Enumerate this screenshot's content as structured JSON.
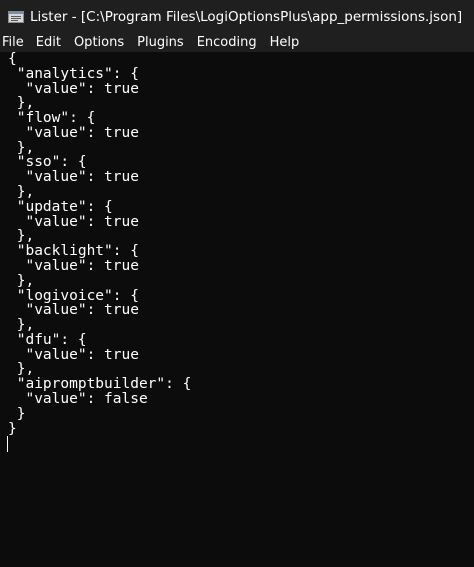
{
  "window": {
    "title": "Lister - [C:\\Program Files\\LogiOptionsPlus\\app_permissions.json]",
    "icon": "lister-app-icon"
  },
  "menu": {
    "items": [
      "File",
      "Edit",
      "Options",
      "Plugins",
      "Encoding",
      "Help"
    ]
  },
  "document": {
    "text": "{\n \"analytics\": {\n  \"value\": true\n },\n \"flow\": {\n  \"value\": true\n },\n \"sso\": {\n  \"value\": true\n },\n \"update\": {\n  \"value\": true\n },\n \"backlight\": {\n  \"value\": true\n },\n \"logivoice\": {\n  \"value\": true\n },\n \"dfu\": {\n  \"value\": true\n },\n \"aipromptbuilder\": {\n  \"value\": false\n }\n}"
  },
  "colors": {
    "background": "#0c0c0c",
    "titlebar": "#1f1f1f",
    "text": "#ffffff"
  }
}
